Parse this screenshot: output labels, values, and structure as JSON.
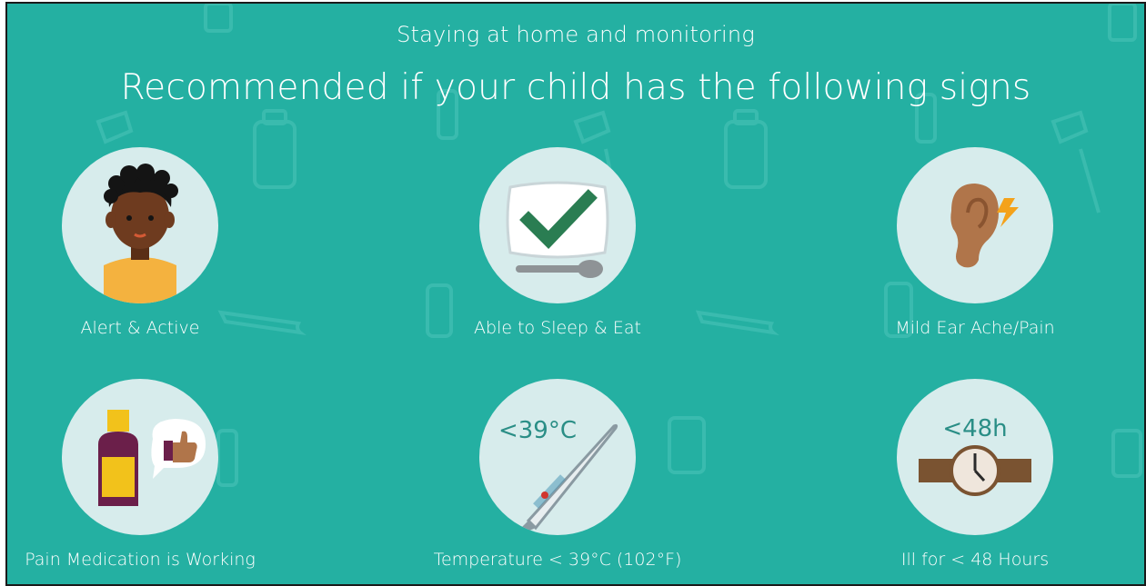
{
  "header": {
    "subtitle": "Staying at home and monitoring",
    "title": "Recommended if your child has the following signs"
  },
  "signs": [
    {
      "label": "Alert & Active",
      "icon": "child-face-icon"
    },
    {
      "label": "Able to Sleep & Eat",
      "icon": "pillow-check-spoon-icon"
    },
    {
      "label": "Mild Ear Ache/Pain",
      "icon": "ear-pain-icon"
    },
    {
      "label": "Pain Medication is Working",
      "icon": "medicine-thumbs-up-icon"
    },
    {
      "label": "Temperature < 39°C (102°F)",
      "icon": "thermometer-icon",
      "overlay": "<39°C"
    },
    {
      "label": "Ill for < 48 Hours",
      "icon": "watch-icon",
      "overlay": "<48h"
    }
  ],
  "colors": {
    "background": "#24b0a2",
    "circle": "#d7ecec",
    "check": "#2a7d52",
    "skin": "#6e3b1f",
    "shirt": "#f4b23f",
    "medicine_bottle": "#6b1f4a",
    "medicine_label": "#f2c21b",
    "watch_strap": "#7a5331"
  }
}
